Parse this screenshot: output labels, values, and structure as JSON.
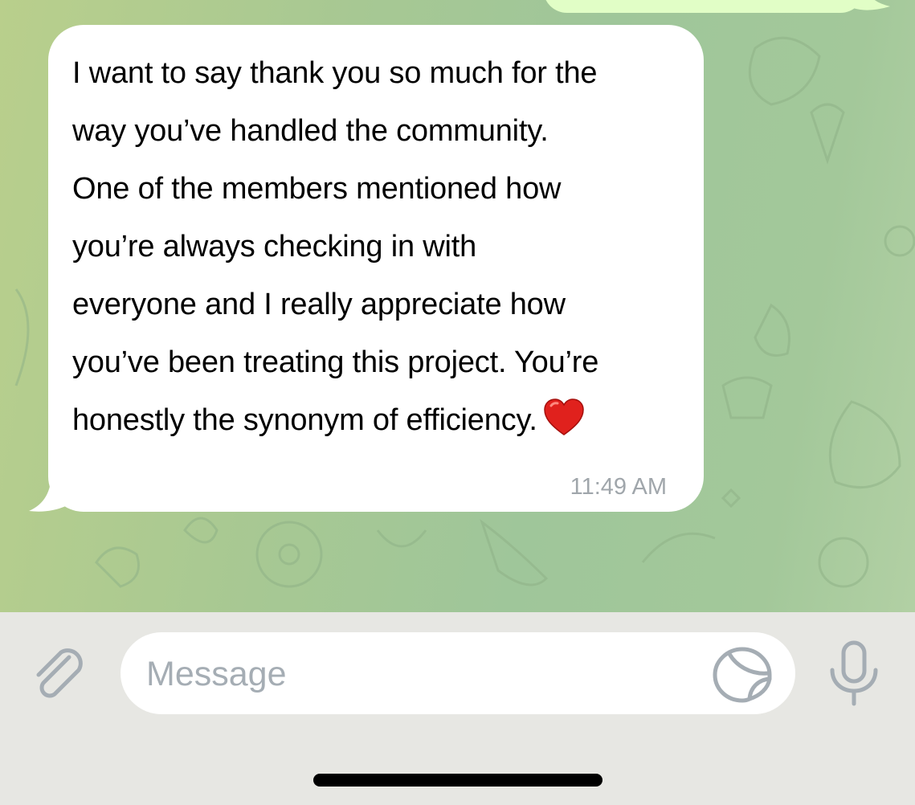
{
  "chat": {
    "incoming_message": {
      "lines": [
        "I want to say thank you so much for the",
        "way you’ve handled the community.",
        "One of the members mentioned how",
        "you’re always checking in with",
        "everyone and I really appreciate how",
        "you’ve been treating this project. You’re",
        "honestly the synonym of efficiency."
      ],
      "emoji": "heart-emoji",
      "time": "11:49 AM"
    },
    "colors": {
      "wallpaper": "#a7c893",
      "incoming_bubble": "#ffffff",
      "outgoing_bubble": "#e1fec6",
      "timestamp": "#a0a6ab"
    }
  },
  "composer": {
    "placeholder": "Message",
    "value": "",
    "attach_icon": "paperclip-icon",
    "sticker_icon": "sticker-icon",
    "mic_icon": "microphone-icon",
    "background": "#e7e7e3",
    "icon_color": "#a5adb4"
  }
}
